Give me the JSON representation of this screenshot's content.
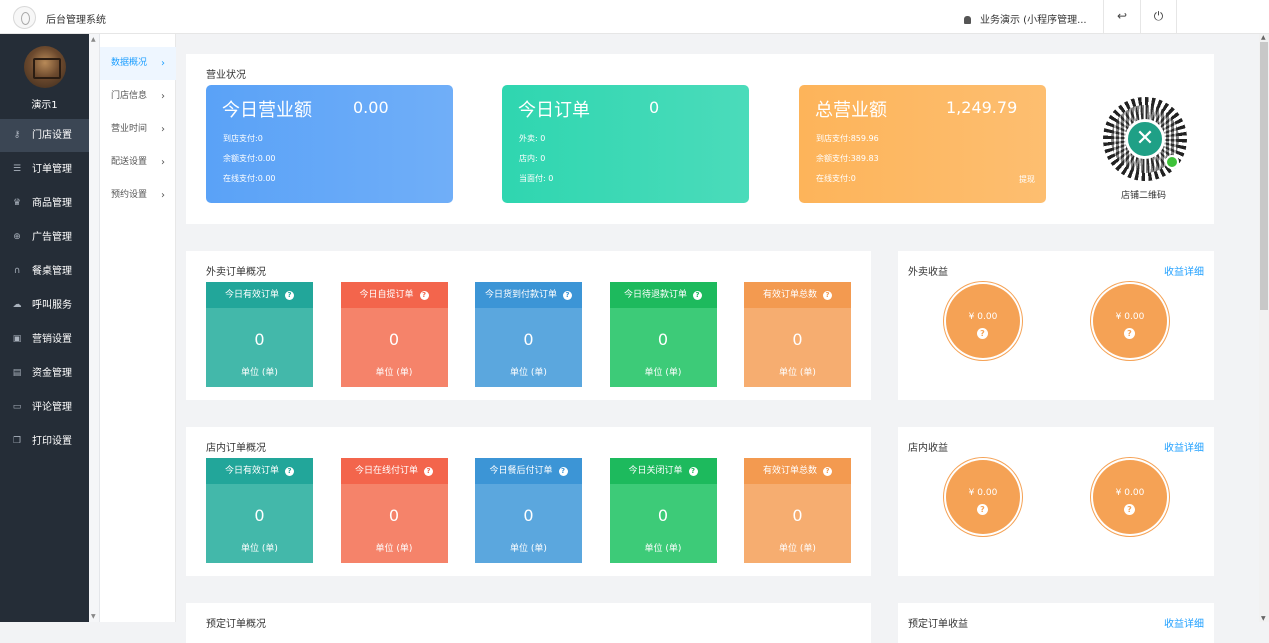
{
  "app": {
    "title": "后台管理系统"
  },
  "header": {
    "user": "业务演示 (小程序管理...",
    "back_icon": "↩",
    "power_icon": "⏻"
  },
  "sidebar": {
    "username": "演示1",
    "items": [
      {
        "label": "门店设置",
        "icon": "key-icon",
        "glyph": "⚷",
        "active": true
      },
      {
        "label": "订单管理",
        "icon": "list-icon",
        "glyph": "☰"
      },
      {
        "label": "商品管理",
        "icon": "trophy-icon",
        "glyph": "♛"
      },
      {
        "label": "广告管理",
        "icon": "globe-icon",
        "glyph": "⊕"
      },
      {
        "label": "餐桌管理",
        "icon": "binoculars-icon",
        "glyph": "∩"
      },
      {
        "label": "呼叫服务",
        "icon": "cloud-icon",
        "glyph": "☁"
      },
      {
        "label": "营销设置",
        "icon": "gift-icon",
        "glyph": "▣"
      },
      {
        "label": "资金管理",
        "icon": "wallet-icon",
        "glyph": "▤"
      },
      {
        "label": "评论管理",
        "icon": "money-icon",
        "glyph": "▭"
      },
      {
        "label": "打印设置",
        "icon": "copy-icon",
        "glyph": "❐"
      }
    ]
  },
  "submenu": {
    "items": [
      {
        "label": "数据概况",
        "active": true
      },
      {
        "label": "门店信息"
      },
      {
        "label": "营业时间"
      },
      {
        "label": "配送设置"
      },
      {
        "label": "预约设置"
      }
    ],
    "chevron": "›"
  },
  "business": {
    "title": "营业状况",
    "cards": [
      {
        "title": "今日营业额",
        "value": "0.00",
        "color": "#5aa2f7",
        "lines": [
          "到店支付:0",
          "余额支付:0.00",
          "在线支付:0.00"
        ]
      },
      {
        "title": "今日订单",
        "value": "0",
        "color": "#2fd6b0",
        "lines": [
          "外卖: 0",
          "店内: 0",
          "当面付: 0"
        ]
      },
      {
        "title": "总营业额",
        "value": "1,249.79",
        "color": "#fdb45a",
        "lines": [
          "到店支付:859.96",
          "余额支付:389.83",
          "在线支付:0"
        ],
        "extra": "提现"
      }
    ],
    "qr_label": "店铺二维码"
  },
  "takeout": {
    "title": "外卖订单概况",
    "cards": [
      {
        "label": "今日有效订单",
        "value": "0",
        "unit": "单位 (单)",
        "head": "#22a69a",
        "body": "#43b8aa"
      },
      {
        "label": "今日自提订单",
        "value": "0",
        "unit": "单位 (单)",
        "head": "#f3654c",
        "body": "#f5836a"
      },
      {
        "label": "今日货到付款订单",
        "value": "0",
        "unit": "单位 (单)",
        "head": "#3c95d6",
        "body": "#5ba7de"
      },
      {
        "label": "今日待退款订单",
        "value": "0",
        "unit": "单位 (单)",
        "head": "#1dba5d",
        "body": "#3dcb78"
      },
      {
        "label": "有效订单总数",
        "value": "0",
        "unit": "单位 (单)",
        "head": "#f39a50",
        "body": "#f6ad70"
      }
    ]
  },
  "takeout_income": {
    "title": "外卖收益",
    "link": "收益详细",
    "values": [
      "¥ 0.00",
      "¥ 0.00"
    ]
  },
  "instore": {
    "title": "店内订单概况",
    "cards": [
      {
        "label": "今日有效订单",
        "value": "0",
        "unit": "单位 (单)",
        "head": "#22a69a",
        "body": "#43b8aa"
      },
      {
        "label": "今日在线付订单",
        "value": "0",
        "unit": "单位 (单)",
        "head": "#f3654c",
        "body": "#f5836a"
      },
      {
        "label": "今日餐后付订单",
        "value": "0",
        "unit": "单位 (单)",
        "head": "#3c95d6",
        "body": "#5ba7de"
      },
      {
        "label": "今日关闭订单",
        "value": "0",
        "unit": "单位 (单)",
        "head": "#1dba5d",
        "body": "#3dcb78"
      },
      {
        "label": "有效订单总数",
        "value": "0",
        "unit": "单位 (单)",
        "head": "#f39a50",
        "body": "#f6ad70"
      }
    ]
  },
  "instore_income": {
    "title": "店内收益",
    "link": "收益详细",
    "values": [
      "¥ 0.00",
      "¥ 0.00"
    ]
  },
  "reserve": {
    "title": "预定订单概况"
  },
  "reserve_income": {
    "title": "预定订单收益",
    "link": "收益详细"
  }
}
